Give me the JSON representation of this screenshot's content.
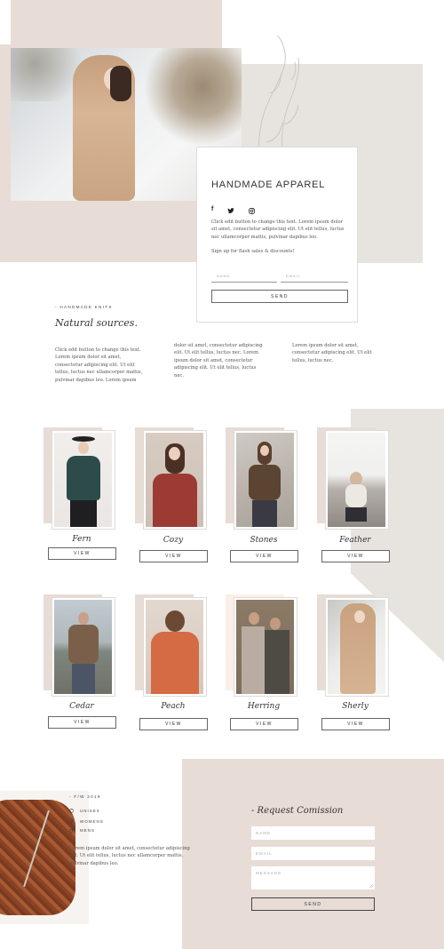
{
  "hero": {
    "signature": "Amanda Santos",
    "title": "HANDMADE APPAREL",
    "social": [
      "facebook-icon",
      "twitter-icon",
      "instagram-icon"
    ],
    "body": "Click edit button to change this text. Lorem ipsum dolor sit amet, consectetur adipiscing elit. Ut elit tellus, luctus nec ullamcorper mattis, pulvinar dapibus leo.",
    "signup": "Sign up for flash sales & discounts!",
    "name_placeholder": "NAME",
    "email_placeholder": "EMAIL",
    "send_label": "SEND"
  },
  "about": {
    "eyebrow": "- HANDMADE KNITS",
    "heading": "Natural sources.",
    "col1": "Click edit button to change this text. Lorem ipsum dolor sit amet, consectetur adipiscing elit. Ut elit tellus, luctus nec ullamcorper mattis, pulvinar dapibus leo.  Lorem ipsum",
    "col2": "dolor sit amet, consectetur adipiscing elit. Ut elit tellus, luctus nec.  Lorem ipsum dolor sit amet, consectetur adipiscing elit. Ut elit tellus, luctus nec.",
    "col3": "Lorem ipsum dolor sit amet, consectetur adipiscing elit. Ut elit tellus, luctus nec."
  },
  "products": [
    {
      "name": "Fern",
      "view": "VIEW"
    },
    {
      "name": "Cozy",
      "view": "VIEW"
    },
    {
      "name": "Stones",
      "view": "VIEW"
    },
    {
      "name": "Feather",
      "view": "VIEW"
    },
    {
      "name": "Cedar",
      "view": "VIEW"
    },
    {
      "name": "Peach",
      "view": "VIEW"
    },
    {
      "name": "Herring",
      "view": "VIEW"
    },
    {
      "name": "Sherly",
      "view": "VIEW"
    }
  ],
  "collection": {
    "eyebrow": "- F/W 2019",
    "menu": [
      {
        "icon": "circle-icon",
        "label": "UNISEX"
      },
      {
        "icon": "pin-icon",
        "label": "WOMENS"
      },
      {
        "icon": "male-icon",
        "label": "MENS"
      }
    ],
    "body": "Lorem ipsum dolor sit amet, consectetur adipiscing elit. Ut elit tellus, luctus nec ullamcorper mattis, pulvinar dapibus leo."
  },
  "commission": {
    "heading": "- Request Comission",
    "name_placeholder": "NAME",
    "email_placeholder": "EMAIL",
    "message_placeholder": "MESSAGE",
    "send_label": "SEND"
  },
  "colors": {
    "blush": "#e8dcd6",
    "stone": "#e7e4df",
    "accent": "#333333"
  }
}
